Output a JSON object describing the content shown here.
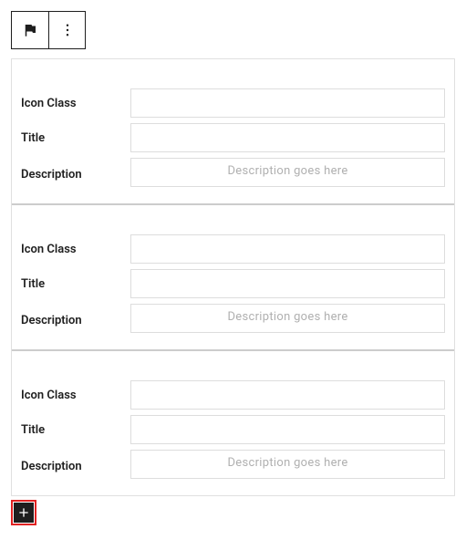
{
  "toolbar": {
    "block_icon": "flag-icon",
    "more_icon": "more-vertical-icon"
  },
  "items": [
    {
      "icon_class_label": "Icon Class",
      "icon_class_value": "",
      "title_label": "Title",
      "title_value": "",
      "description_label": "Description",
      "description_value": "",
      "description_placeholder": "Description goes here"
    },
    {
      "icon_class_label": "Icon Class",
      "icon_class_value": "",
      "title_label": "Title",
      "title_value": "",
      "description_label": "Description",
      "description_value": "",
      "description_placeholder": "Description goes here"
    },
    {
      "icon_class_label": "Icon Class",
      "icon_class_value": "",
      "title_label": "Title",
      "title_value": "",
      "description_label": "Description",
      "description_value": "",
      "description_placeholder": "Description goes here"
    }
  ],
  "add_button": {
    "icon": "plus-icon"
  }
}
